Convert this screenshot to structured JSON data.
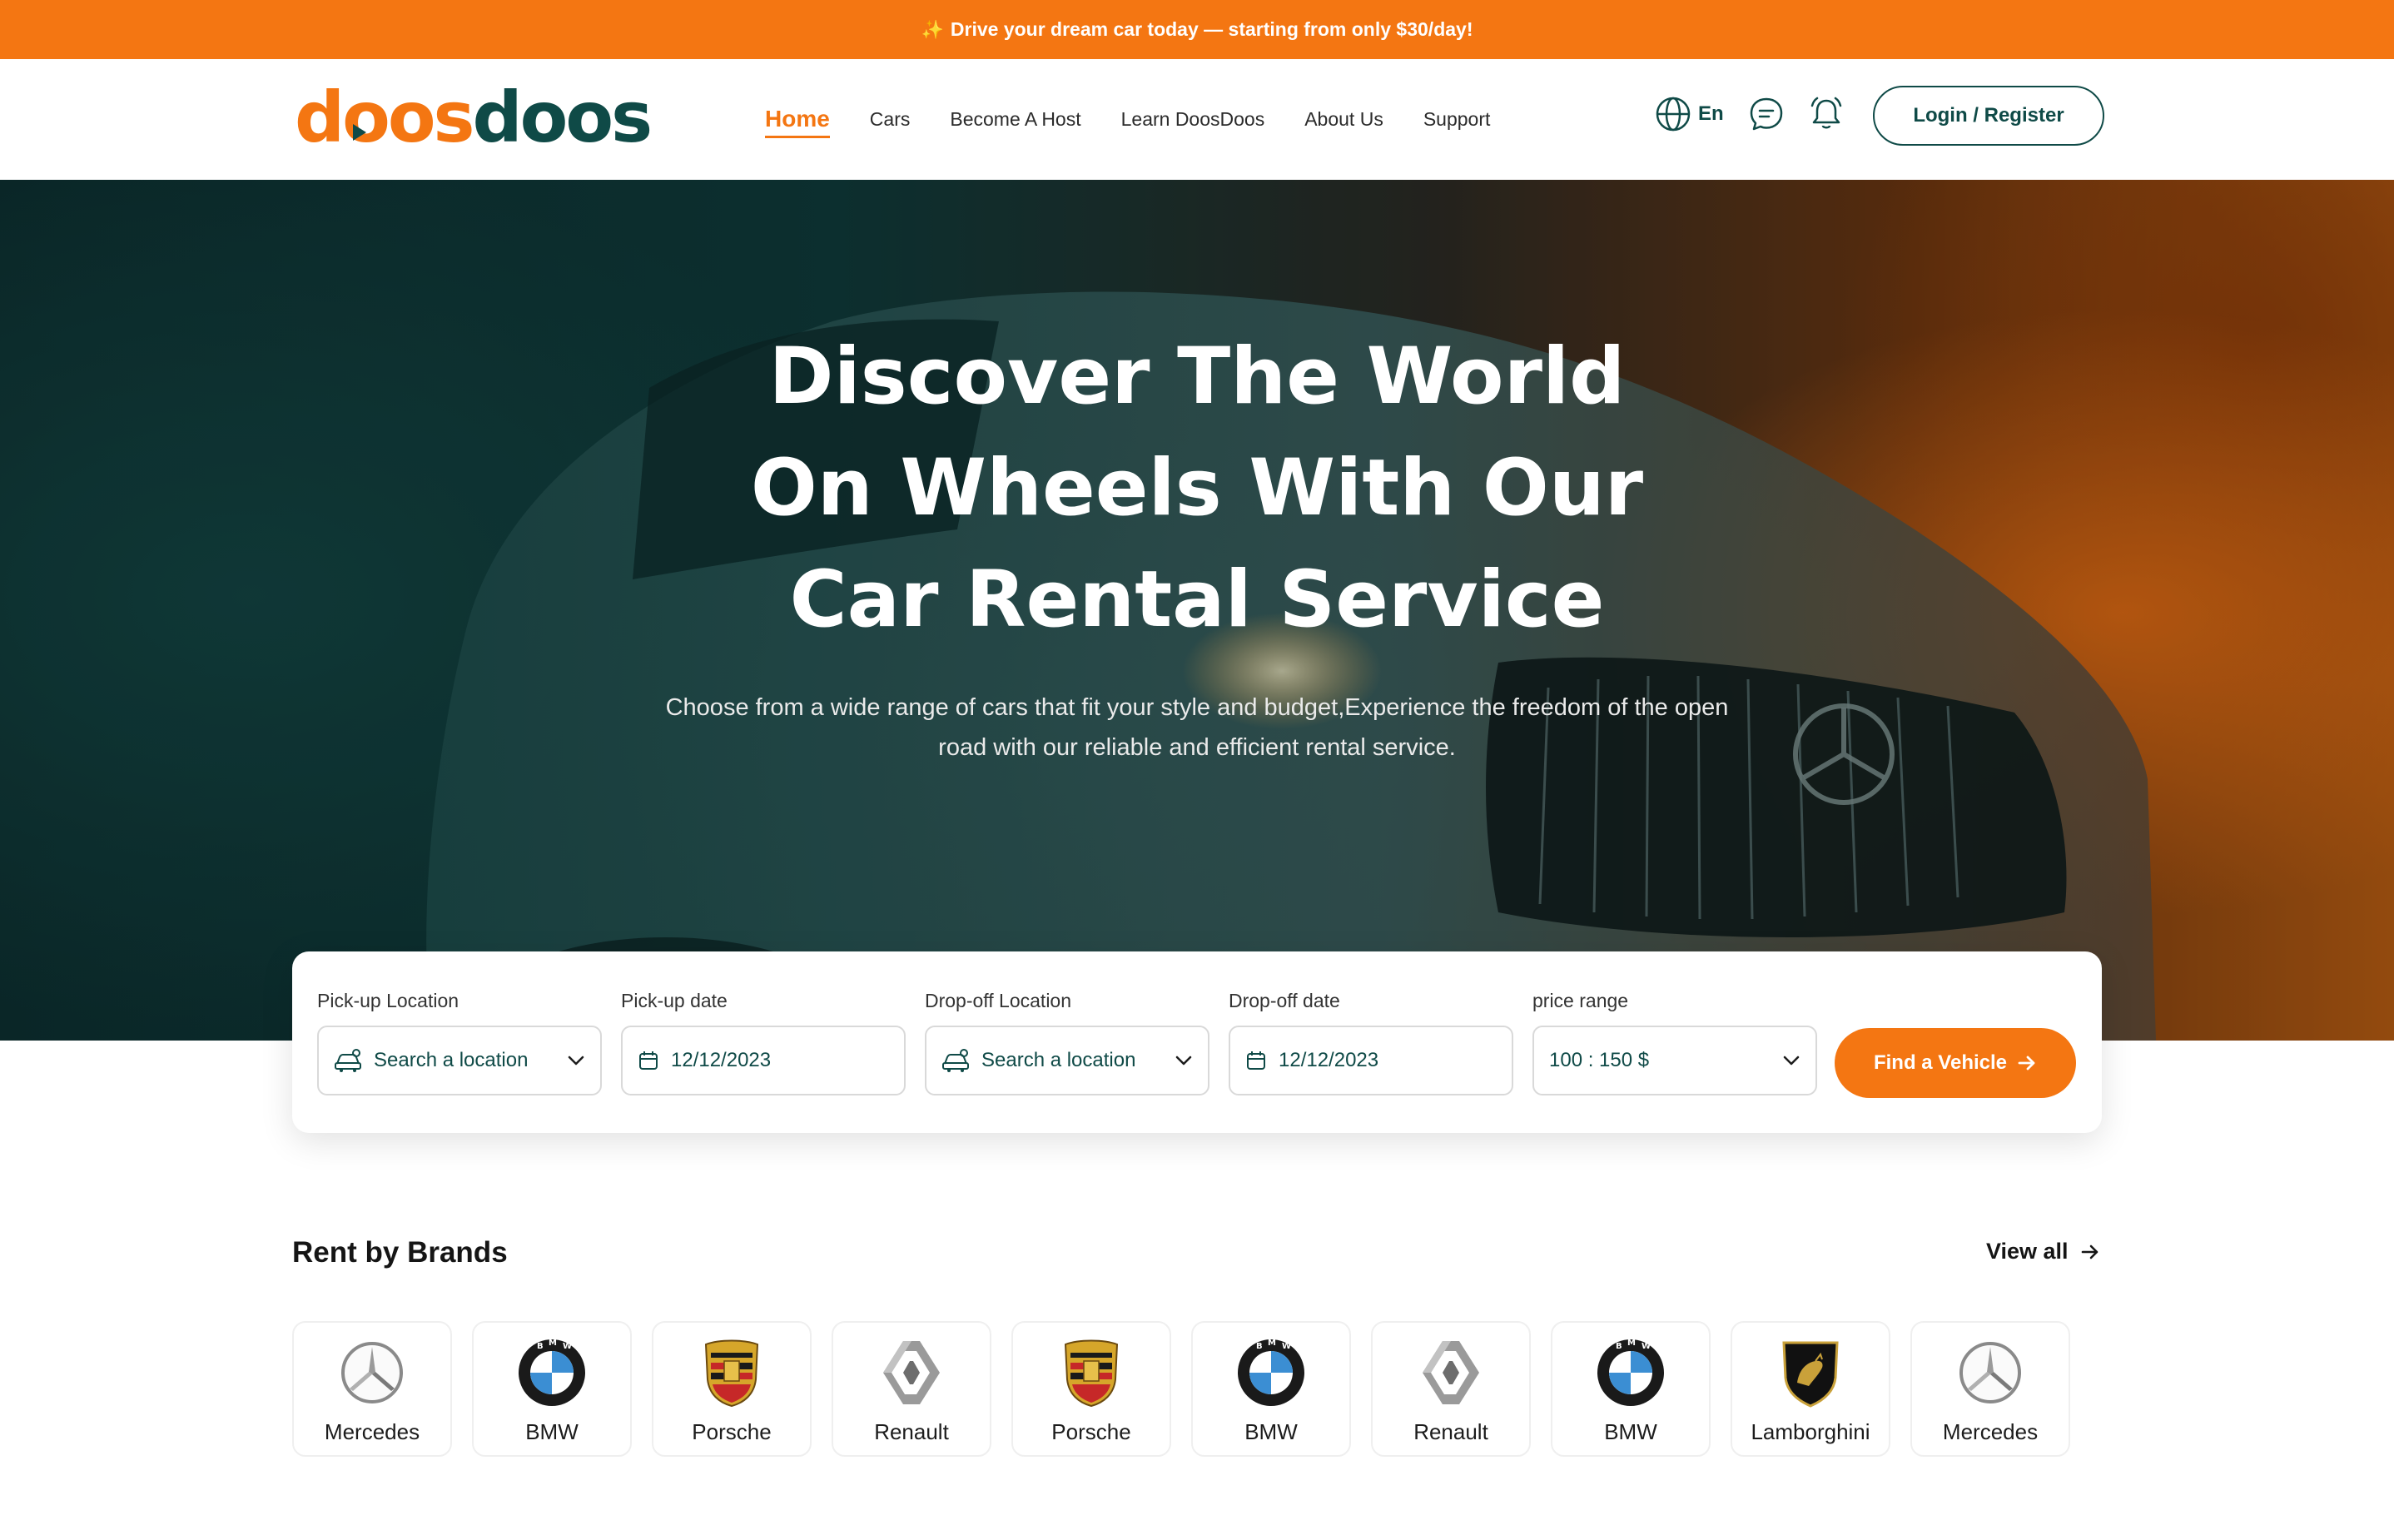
{
  "announcement": {
    "icon": "sparkle-icon",
    "text": "Drive your dream car today — starting from only $30/day!"
  },
  "header": {
    "logo_part1": "doos",
    "logo_part2": "doos",
    "nav": [
      {
        "label": "Home",
        "active": true
      },
      {
        "label": "Cars",
        "active": false
      },
      {
        "label": "Become A Host",
        "active": false
      },
      {
        "label": "Learn DoosDoos",
        "active": false
      },
      {
        "label": "About Us",
        "active": false
      },
      {
        "label": "Support",
        "active": false
      }
    ],
    "language": "En",
    "login_label": "Login / Register"
  },
  "hero": {
    "title": "Discover The World On Wheels With Our Car Rental Service",
    "subtitle": "Choose from a wide range of cars that fit your style and budget,Experience the freedom of the open road with our reliable and efficient rental service."
  },
  "search": {
    "pickup_location": {
      "label": "Pick-up Location",
      "value": "Search a location"
    },
    "pickup_date": {
      "label": "Pick-up date",
      "value": "12/12/2023"
    },
    "dropoff_location": {
      "label": "Drop-off Location",
      "value": "Search a location"
    },
    "dropoff_date": {
      "label": "Drop-off date",
      "value": "12/12/2023"
    },
    "price_range": {
      "label": "price range",
      "value": "100 : 150 $"
    },
    "find_label": "Find a Vehicle"
  },
  "brands": {
    "title": "Rent by Brands",
    "view_all": "View all",
    "items": [
      {
        "name": "Mercedes",
        "icon": "mercedes-logo-icon"
      },
      {
        "name": "BMW",
        "icon": "bmw-logo-icon"
      },
      {
        "name": "Porsche",
        "icon": "porsche-logo-icon"
      },
      {
        "name": "Renault",
        "icon": "renault-logo-icon"
      },
      {
        "name": "Porsche",
        "icon": "porsche-logo-icon"
      },
      {
        "name": "BMW",
        "icon": "bmw-logo-icon"
      },
      {
        "name": "Renault",
        "icon": "renault-logo-icon"
      },
      {
        "name": "BMW",
        "icon": "bmw-logo-icon"
      },
      {
        "name": "Lamborghini",
        "icon": "lamborghini-logo-icon"
      },
      {
        "name": "Mercedes",
        "icon": "mercedes-logo-icon"
      }
    ]
  },
  "colors": {
    "brand_orange": "#f47612",
    "brand_teal": "#0f4a47"
  }
}
